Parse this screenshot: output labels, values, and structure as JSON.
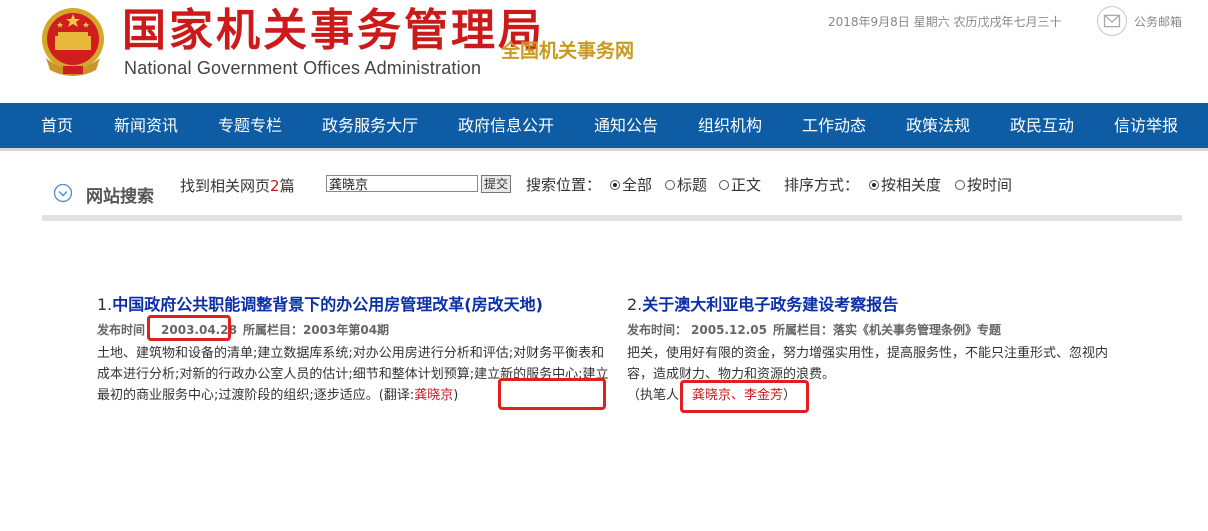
{
  "header": {
    "title_cn": "国家机关事务管理局",
    "title_en": "National Government Offices Administration",
    "site_name": "全国机关事务网",
    "date_text": "2018年9月8日 星期六 农历戊戌年七月三十",
    "mail_label": "公务邮箱"
  },
  "nav": {
    "items": [
      "首页",
      "新闻资讯",
      "专题专栏",
      "政务服务大厅",
      "政府信息公开",
      "通知公告",
      "组织机构",
      "工作动态",
      "政策法规",
      "政民互动",
      "信访举报"
    ]
  },
  "search": {
    "title": "网站搜索",
    "found_prefix": "找到相关网页",
    "found_count": "2",
    "found_suffix": "篇",
    "keyword": "龚晓京",
    "submit_label": "提交",
    "position_label": "搜索位置：",
    "position_options": [
      "全部",
      "标题",
      "正文"
    ],
    "position_selected": "全部",
    "sort_label": "排序方式：",
    "sort_options": [
      "按相关度",
      "按时间"
    ],
    "sort_selected": "按相关度"
  },
  "results": [
    {
      "index": "1.",
      "title": "中国政府公共职能调整背景下的办公用房管理改革(房改天地)",
      "date_label": "发布时间：",
      "date": "2003.04.28",
      "column_label": "所属栏目：",
      "column": "2003年第04期",
      "body": "土地、建筑物和设备的清单;建立数据库系统;对办公用房进行分析和评估;对财务平衡表和成本进行分析;对新的行政办公室人员的估计;细节和整体计划预算;建立新的服务中心;建立最初的商业服务中心;过渡阶段的组织;逐步适应。",
      "credit_prefix": "(翻译:",
      "credit_name": "龚晓京",
      "credit_suffix": ")"
    },
    {
      "index": "2.",
      "title": "关于澳大利亚电子政务建设考察报告",
      "date_label": "发布时间：",
      "date": "2005.12.05",
      "column_label": "所属栏目：",
      "column": "落实《机关事务管理条例》专题",
      "body": "把关，使用好有限的资金，努力增强实用性，提高服务性，不能只注重形式、忽视内容，造成财力、物力和资源的浪费。",
      "credit_prefix": "（执笔人：",
      "credit_name": "龚晓京、李金芳",
      "credit_suffix": "）"
    }
  ]
}
